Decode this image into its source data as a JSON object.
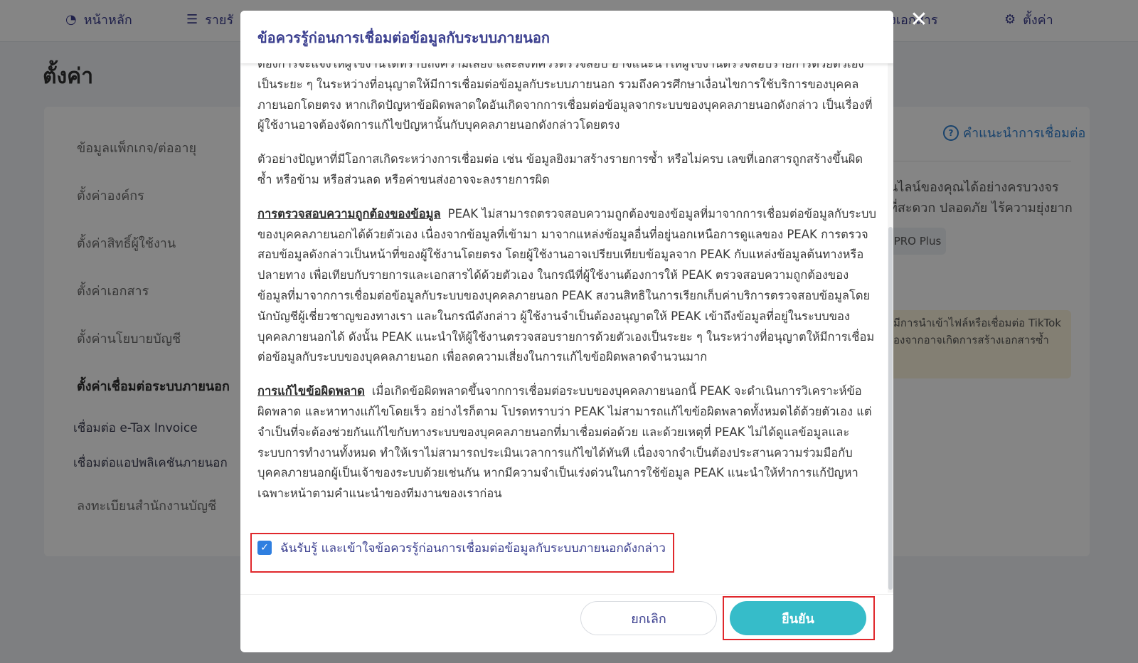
{
  "nav": {
    "items": [
      {
        "label": "หน้าหลัก",
        "icon": "dashboard-icon"
      },
      {
        "label": "รายรั",
        "icon": "list-icon"
      },
      {
        "label": "คลังเอกสาร",
        "icon": "archive-icon"
      },
      {
        "label": "ตั้งค่า",
        "icon": "gear-icon"
      }
    ]
  },
  "page": {
    "title": "ตั้งค่า",
    "sidebar": [
      "ข้อมูลแพ็กเกจ/ต่ออายุ",
      "ตั้งค่าองค์กร",
      "ตั้งค่าสิทธิ์ผู้ใช้งาน",
      "ตั้งค่าเอกสาร",
      "ตั้งค่านโยบายบัญชี",
      "ตั้งค่าเชื่อมต่อระบบภายนอก"
    ],
    "sidebar_sub": [
      "เชื่อมต่อ e-Tax Invoice",
      "เชื่อมต่อแอปพลิเคชันภายนอก"
    ],
    "sidebar_last": "ลงทะเบียนสำนักงานบัญชี",
    "help_link": "คำแนะนำการเชื่อมต่อ",
    "right_line1": "นไลน์ของคุณได้อย่างครบวงจร",
    "right_line2": "ที่สะดวก ปลอดภัย ไร้ความยุ่งยาก",
    "pro_badge": "PRO Plus",
    "notice_line1": "มีการนำเข้าไฟล์หรือเชื่อมต่อ TikTok",
    "notice_line2": "องจากอาจเกิดการสร้างเอกสารซ้ำ"
  },
  "modal": {
    "title": "ข้อควรรู้ก่อนการเชื่อมต่อข้อมูลกับระบบภายนอก",
    "para0": "ต้องการจะแจ้งให้ผู้ใช้งานได้ทราบถึงความเสี่ยง และสิ่งที่ควรตรวจสอบ อาจแนะนำให้ผู้ใช้งานตรวจสอบรายการด้วยตัวเองเป็นระยะ ๆ ในระหว่างที่อนุญาตให้มีการเชื่อมต่อข้อมูลกับระบบภายนอก รวมถึงควรศึกษาเงื่อนไขการใช้บริการของบุคคลภายนอกโดยตรง หากเกิดปัญหาข้อผิดพลาดใดอันเกิดจากการเชื่อมต่อข้อมูลจากระบบของบุคคลภายนอกดังกล่าว เป็นเรื่องที่ผู้ใช้งานอาจต้องจัดการแก้ไขปัญหานั้นกับบุคคลภายนอกดังกล่าวโดยตรง",
    "para1": "ตัวอย่างปัญหาที่มีโอกาสเกิดระหว่างการเชื่อมต่อ เช่น ข้อมูลยิงมาสร้างรายการซ้ำ หรือไม่ครบ เลขที่เอกสารถูกสร้างขึ้นผิด ซ้ำ หรือข้าม หรือส่วนลด หรือค่าขนส่งอาจจะลงรายการผิด",
    "section2_heading": "การตรวจสอบความถูกต้องของข้อมูล",
    "section2_body": "PEAK ไม่สามารถตรวจสอบความถูกต้องของข้อมูลที่มาจากการเชื่อมต่อข้อมูลกับระบบของบุคคลภายนอกได้ด้วยตัวเอง เนื่องจากข้อมูลที่เข้ามา มาจากแหล่งข้อมูลอื่นที่อยู่นอกเหนือการดูแลของ PEAK การตรวจสอบข้อมูลดังกล่าวเป็นหน้าที่ของผู้ใช้งานโดยตรง โดยผู้ใช้งานอาจเปรียบเทียบข้อมูลจาก PEAK กับแหล่งข้อมูลต้นทางหรือปลายทาง เพื่อเทียบกับรายการและเอกสารได้ด้วยตัวเอง ในกรณีที่ผู้ใช้งานต้องการให้ PEAK ตรวจสอบความถูกต้องของข้อมูลที่มาจากการเชื่อมต่อข้อมูลกับระบบของบุคคลภายนอก PEAK สงวนสิทธิในการเรียกเก็บค่าบริการตรวจสอบข้อมูลโดยนักบัญชีผู้เชี่ยวชาญของทางเรา และในกรณีดังกล่าว ผู้ใช้งานจำเป็นต้องอนุญาตให้ PEAK เข้าถึงข้อมูลที่อยู่ในระบบของบุคคลภายนอกได้ ดังนั้น PEAK แนะนำให้ผู้ใช้งานตรวจสอบรายการด้วยตัวเองเป็นระยะ ๆ ในระหว่างที่อนุญาตให้มีการเชื่อมต่อข้อมูลกับระบบของบุคคลภายนอก เพื่อลดความเสี่ยงในการแก้ไขข้อผิดพลาดจำนวนมาก",
    "section3_heading": "การแก้ไขข้อผิดพลาด",
    "section3_body": "เมื่อเกิดข้อผิดพลาดขึ้นจากการเชื่อมต่อระบบของบุคคลภายนอกนี้ PEAK จะดำเนินการวิเคราะห์ข้อผิดพลาด และหาทางแก้ไขโดยเร็ว อย่างไรก็ตาม โปรดทราบว่า PEAK ไม่สามารถแก้ไขข้อผิดพลาดทั้งหมดได้ด้วยตัวเอง แต่จำเป็นที่จะต้องช่วยกันแก้ไขกับทางระบบของบุคคลภายนอกที่มาเชื่อมต่อด้วย และด้วยเหตุที่ PEAK ไม่ได้ดูแลข้อมูลและระบบการทำงานทั้งหมด ทำให้เราไม่สามารถประเมินเวลาการแก้ไขได้ทันที เนื่องจากจำเป็นต้องประสานความร่วมมือกับบุคคลภายนอกผู้เป็นเจ้าของระบบด้วยเช่นกัน หากมีความจำเป็นเร่งด่วนในการใช้ข้อมูล PEAK แนะนำให้ทำการแก้ปัญหาเฉพาะหน้าตามคำแนะนำของทีมงานของเราก่อน",
    "agree_label": "ฉันรับรู้ และเข้าใจข้อควรรู้ก่อนการเชื่อมต่อข้อมูลกับระบบภายนอกดังกล่าว",
    "agree_checked": true,
    "cancel_label": "ยกเลิก",
    "confirm_label": "ยืนยัน",
    "close_icon": "close-icon"
  },
  "colors": {
    "brand": "#3b3f8f",
    "confirm": "#36bcc9",
    "highlight": "#e0282c",
    "checkbox": "#2f7fe0"
  }
}
